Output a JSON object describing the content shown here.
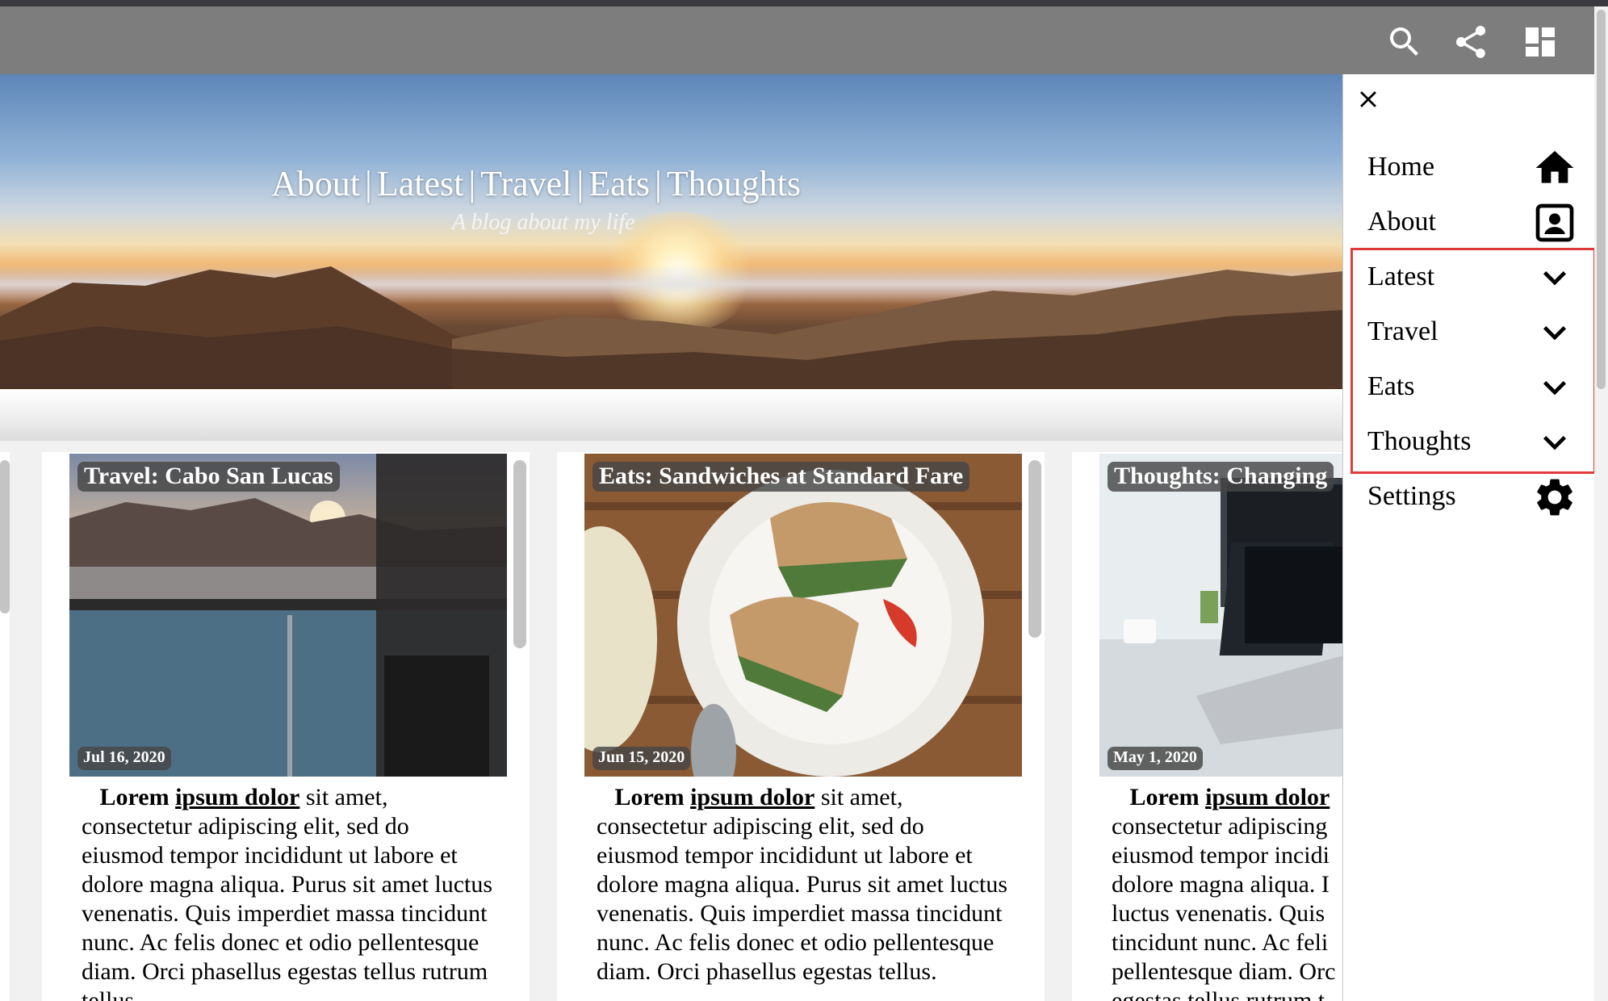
{
  "toolbar": {
    "icons": [
      "search-icon",
      "share-icon",
      "dashboard-icon"
    ]
  },
  "hero": {
    "nav": [
      "About",
      "Latest",
      "Travel",
      "Eats",
      "Thoughts"
    ],
    "separator": "|",
    "subtitle": "A blog about my life"
  },
  "cards": [
    {
      "tag": "Travel: Cabo San Lucas",
      "date": "Jul 16, 2020",
      "lead_bold": "Lorem",
      "lead_link": "ipsum dolor",
      "text": "sit amet, consectetur adipiscing elit, sed do eiusmod tempor incididunt ut labore et dolore magna aliqua. Purus sit amet luctus venenatis. Quis imperdiet massa tincidunt nunc. Ac felis donec et odio pellentesque diam. Orci phasellus egestas tellus rutrum tellus."
    },
    {
      "tag": "Eats: Sandwiches at Standard Fare",
      "date": "Jun 15, 2020",
      "lead_bold": "Lorem",
      "lead_link": "ipsum dolor",
      "text": "sit amet, consectetur adipiscing elit, sed do eiusmod tempor incididunt ut labore et dolore magna aliqua. Purus sit amet luctus venenatis. Quis imperdiet massa tincidunt nunc. Ac felis donec et odio pellentesque diam. Orci phasellus egestas tellus."
    },
    {
      "tag": "Thoughts: Changing",
      "date": "May 1, 2020",
      "lead_bold": "Lorem",
      "lead_link": "ipsum dolor",
      "text": "consectetur adipiscing eiusmod tempor incidi dolore magna aliqua. I luctus venenatis. Quis tincidunt nunc. Ac feli pellentesque diam. Orc egestas tellus rutrum t"
    }
  ],
  "drawer": {
    "close_icon": "close-icon",
    "items": [
      {
        "label": "Home",
        "icon": "home-icon"
      },
      {
        "label": "About",
        "icon": "contact-icon"
      },
      {
        "label": "Latest",
        "icon": "chevron-down-icon"
      },
      {
        "label": "Travel",
        "icon": "chevron-down-icon"
      },
      {
        "label": "Eats",
        "icon": "chevron-down-icon"
      },
      {
        "label": "Thoughts",
        "icon": "chevron-down-icon"
      },
      {
        "label": "Settings",
        "icon": "gear-icon"
      }
    ]
  },
  "colors": {
    "toolbar": "#7d7d7d",
    "highlight": "#e23a3a",
    "drawer": "#ffffff"
  }
}
